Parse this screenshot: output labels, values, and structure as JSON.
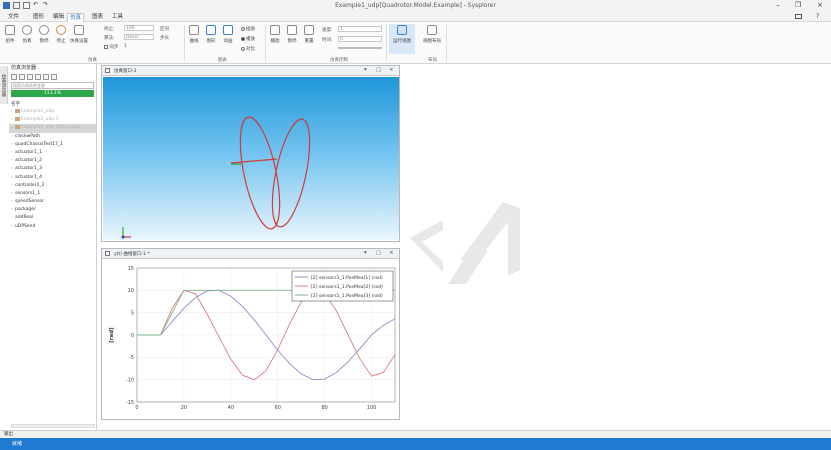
{
  "window": {
    "title": "Example1_udp[Quadrotor.Model.Example] - Sysplorer"
  },
  "menu": [
    "文件",
    "图形",
    "编辑",
    "仿真",
    "图表",
    "工具"
  ],
  "menu_active": 3,
  "ribbon": {
    "sim_buttons": [
      "组件",
      "仿真",
      "暂停",
      "停止",
      "仿真设置"
    ],
    "start_label": "终止:",
    "start_value": "100",
    "algo_label": "算法:",
    "algo_value": "Dassl",
    "interval_label": "区间",
    "sync_label": "同步",
    "plan_value": "1",
    "step_label": "步长",
    "group_sim": "仿真",
    "chart_buttons": [
      "曲线",
      "图形",
      "动画"
    ],
    "radios": [
      "插值",
      "播放",
      "对比"
    ],
    "group_chart": "图表",
    "ctrl_buttons": [
      "播放",
      "暂停",
      "重置"
    ],
    "speed_label": "速度:",
    "time_label": "时间:",
    "speed_value": "1",
    "time_value": "0",
    "group_ctrl": "仿真控制",
    "highlight_button": "运行视图",
    "layout_button": "视图布局",
    "group_layout": "布局"
  },
  "sidebar_tab": "仿真浏览器",
  "explorer": {
    "title": "仿真浏览器",
    "search_placeholder": "搜索仿真结果变量",
    "progress_label": "113.1%",
    "progress": 100,
    "subtitle": "名字",
    "items": [
      {
        "label": "Example1_udp",
        "dim": true,
        "arrow": "›",
        "folder": true
      },
      {
        "label": "Example1_udp 1",
        "dim": true,
        "arrow": "›",
        "folder": true
      },
      {
        "label": "Example1_udp 2(Running)",
        "dim": true,
        "arrow": "⌄",
        "folder": true,
        "selected": true
      },
      {
        "label": "clockwPath",
        "arrow": "›"
      },
      {
        "label": "quadChassisTest17_1",
        "arrow": "›"
      },
      {
        "label": "actuator1_1",
        "arrow": "›"
      },
      {
        "label": "actuator1_2",
        "arrow": "›"
      },
      {
        "label": "actuator1_3",
        "arrow": "›"
      },
      {
        "label": "actuator1_4",
        "arrow": "›"
      },
      {
        "label": "controller2_2",
        "arrow": "›"
      },
      {
        "label": "sensors1_1",
        "arrow": "›"
      },
      {
        "label": "speedSensor",
        "arrow": "›"
      },
      {
        "label": "packager",
        "arrow": "›"
      },
      {
        "label": "addReal",
        "arrow": "›"
      },
      {
        "label": "uDPSend",
        "arrow": "›"
      }
    ]
  },
  "pane3d": {
    "title": "仿真窗口-3",
    "controls": [
      "▾",
      "▢",
      "×"
    ]
  },
  "pane_plot": {
    "title": "y(t) 曲线窗口-1 *",
    "controls": [
      "▾",
      "▢",
      "×"
    ]
  },
  "output_label": "输出",
  "status_text": "就绪",
  "chart_data": {
    "type": "line",
    "x": [
      0,
      5,
      10,
      15,
      20,
      25,
      30,
      35,
      40,
      45,
      50,
      55,
      60,
      65,
      70,
      75,
      80,
      85,
      90,
      95,
      100,
      105,
      110
    ],
    "series": [
      {
        "name": "[2] sensors1_1.PosMea[1] (rad)",
        "color": "#8f8fc8",
        "values": [
          0,
          0,
          0,
          3,
          6,
          8.4,
          9.9,
          10,
          8.7,
          6.4,
          3.4,
          0,
          -3.4,
          -6.4,
          -8.7,
          -10,
          -9.9,
          -8.4,
          -6,
          -3.1,
          0,
          2.2,
          3.6
        ]
      },
      {
        "name": "[2] sensors1_1.PosMea[2] (rad)",
        "color": "#d87f86",
        "values": [
          0,
          0,
          0,
          6,
          10,
          9.2,
          4.6,
          -0.5,
          -5.4,
          -9,
          -10,
          -8,
          -3.3,
          2.4,
          7.4,
          9.9,
          9.3,
          5.4,
          0,
          -5.3,
          -9.2,
          -8.4,
          -4.4
        ]
      },
      {
        "name": "[2] sensors1_1.PosMea[3] (rad)",
        "color": "#7fb58a",
        "values": [
          0,
          0,
          0,
          5,
          10,
          10,
          10,
          10,
          10,
          10,
          10,
          10,
          10,
          10,
          10,
          10,
          10,
          10,
          10,
          10,
          10,
          10,
          10
        ]
      }
    ],
    "xlabel": "",
    "ylabel": "[rad]",
    "xlim": [
      0,
      110
    ],
    "ylim": [
      -15,
      15
    ],
    "xticks": [
      0,
      20,
      40,
      60,
      80,
      100
    ],
    "yticks": [
      -15,
      -10,
      -5,
      0,
      5,
      10,
      15
    ],
    "grid": true,
    "legend": "top-right"
  }
}
